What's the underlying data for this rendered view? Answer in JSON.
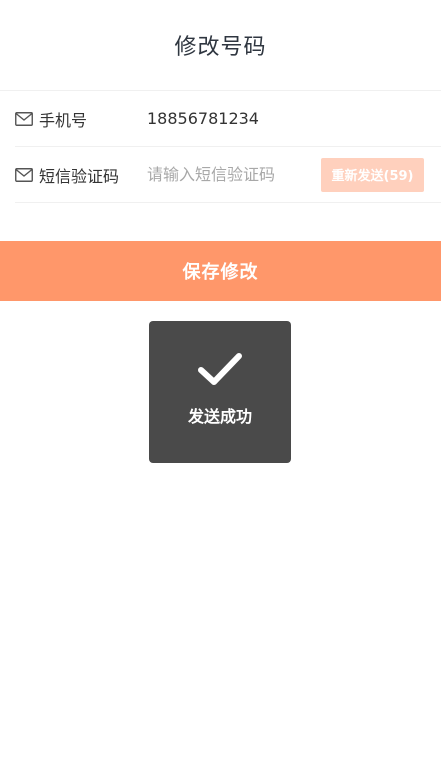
{
  "header": {
    "title": "修改号码"
  },
  "form": {
    "phone": {
      "icon": "mail-icon",
      "label": "手机号",
      "value": "18856781234"
    },
    "sms_code": {
      "icon": "mail-icon",
      "label": "短信验证码",
      "value": "",
      "placeholder": "请输入短信验证码",
      "resend_label": "重新发送(59)"
    }
  },
  "actions": {
    "save_label": "保存修改"
  },
  "toast": {
    "icon": "check-icon",
    "message": "发送成功"
  },
  "colors": {
    "accent": "#ff976a",
    "resend_disabled": "#ffd0bd",
    "toast_bg": "#4a4a4a"
  }
}
